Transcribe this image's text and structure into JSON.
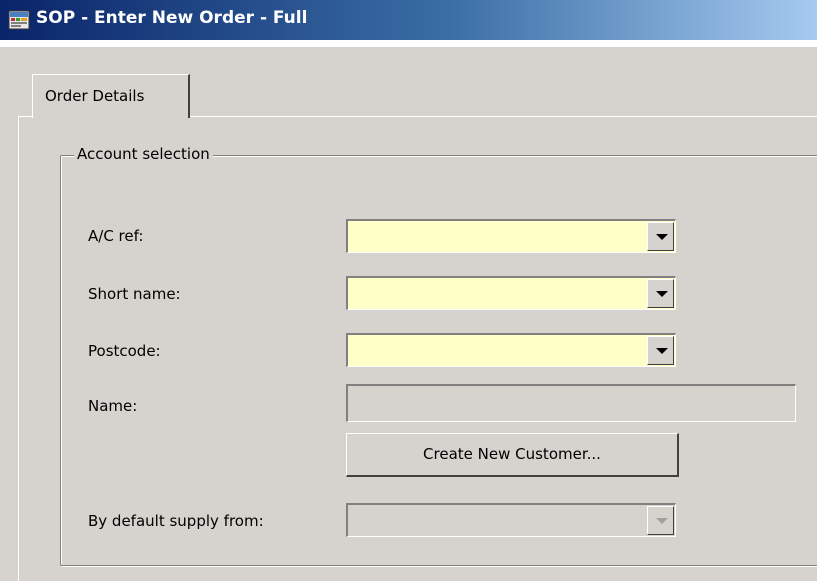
{
  "window": {
    "title": "SOP - Enter New Order - Full",
    "icon": "sage-app-icon"
  },
  "tabs": [
    {
      "label": "Order Details",
      "selected": true
    }
  ],
  "account_selection": {
    "legend": "Account selection",
    "fields": {
      "ac_ref": {
        "label": "A/C ref:",
        "value": ""
      },
      "short_name": {
        "label": "Short name:",
        "value": ""
      },
      "postcode": {
        "label": "Postcode:",
        "value": ""
      },
      "name": {
        "label": "Name:",
        "value": ""
      },
      "supply_from": {
        "label": "By default supply from:",
        "value": ""
      }
    },
    "create_button_label": "Create New Customer..."
  },
  "colors": {
    "window_bg": "#d6d3ce",
    "required_field_bg": "#ffffc8",
    "titlebar_start": "#0a246a",
    "titlebar_end": "#a6caf0"
  }
}
